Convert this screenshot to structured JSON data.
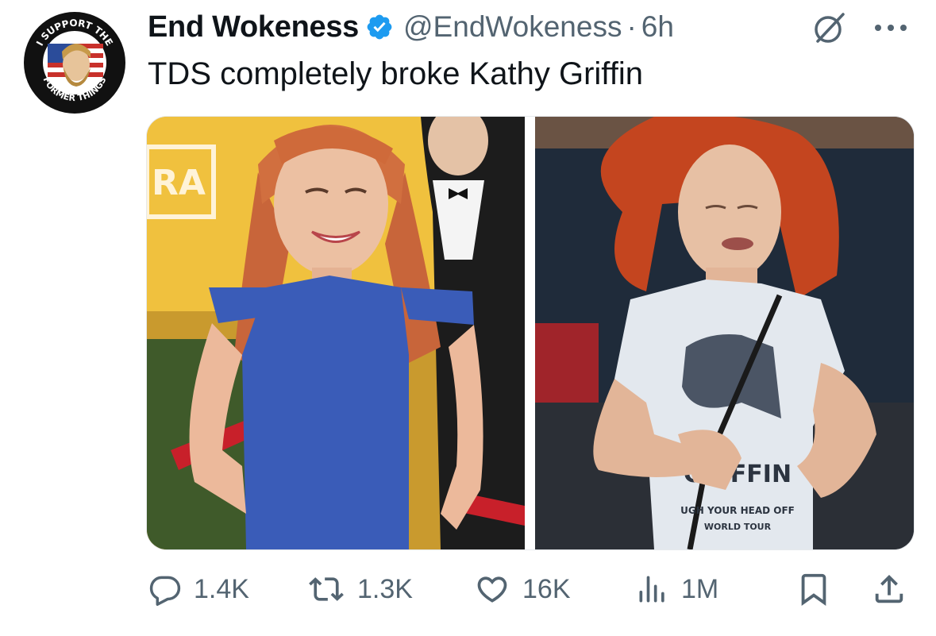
{
  "author": {
    "name": "End Wokeness",
    "handle": "@EndWokeness",
    "separator": "·",
    "time": "6h",
    "avatar_text_top": "I SUPPORT THE",
    "avatar_text_bottom": "FORMER THINGS",
    "verified": true
  },
  "tweet": {
    "text": "TDS completely broke Kathy Griffin"
  },
  "media": {
    "left_sign_text": "RA",
    "right_shirt_text": [
      "GRIFFIN",
      "UGH YOUR HEAD OFF",
      "WORLD TOUR"
    ]
  },
  "actions": {
    "replies": "1.4K",
    "reposts": "1.3K",
    "likes": "16K",
    "views": "1M"
  },
  "colors": {
    "verified_blue": "#1d9bf0",
    "secondary_text": "#536471",
    "dress_blue": "#3a5cb8",
    "hair_red": "#c4451f"
  },
  "icons": [
    "verified-badge-icon",
    "grok-icon",
    "more-icon",
    "reply-icon",
    "repost-icon",
    "like-icon",
    "views-icon",
    "bookmark-icon",
    "share-icon"
  ]
}
